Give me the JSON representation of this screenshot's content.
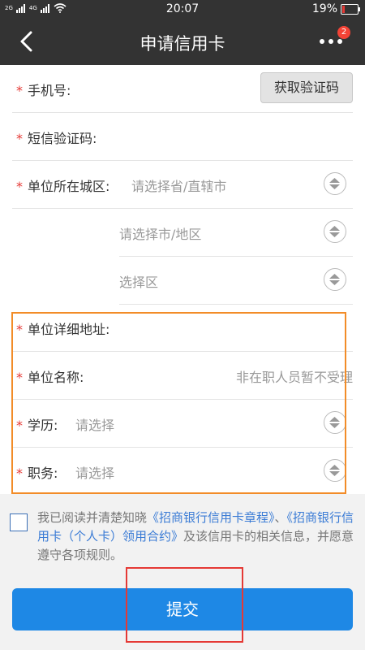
{
  "status_bar": {
    "net_left": "2G",
    "net_right": "4G",
    "time": "20:07",
    "battery": "19%",
    "battery_level": 0.19
  },
  "header": {
    "title": "申请信用卡",
    "badge_count": "2"
  },
  "form": {
    "phone_label": "手机号:",
    "get_code_button": "获取验证码",
    "sms_label": "短信验证码:",
    "city_label": "单位所在城区:",
    "province_placeholder": "请选择省/直辖市",
    "city_placeholder": "请选择市/地区",
    "district_placeholder": "选择区",
    "address_label": "单位详细地址:",
    "company_label": "单位名称:",
    "company_hint": "非在职人员暂不受理",
    "education_label": "学历:",
    "education_placeholder": "请选择",
    "position_label": "职务:",
    "position_placeholder": "请选择",
    "required_mark": "*"
  },
  "agreement": {
    "text_1": "我已阅读并清楚知晓",
    "link_1": "《招商银行信用卡章程》",
    "sep": "、",
    "link_2": "《招商银行信用卡（个人卡）领用合约》",
    "text_2": "及该信用卡的相关信息，并愿意遵守各项规则。"
  },
  "submit_label": "提交",
  "colors": {
    "header_bg": "#333333",
    "accent": "#1e88e5",
    "required": "#e53935",
    "highlight": "#f28c28"
  }
}
